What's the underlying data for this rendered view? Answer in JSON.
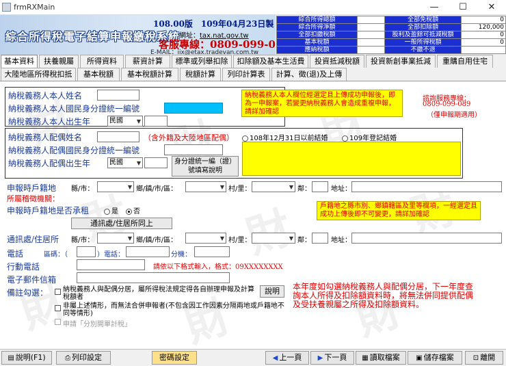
{
  "window": {
    "title": "frmRXMain",
    "minimize": "—",
    "maximize": "☐",
    "close": "✕"
  },
  "banner": {
    "version": "108.00版　109年04月23日製",
    "system_name": "綜合所得稅電子結算申報繳稅系統",
    "site_label": "網址：",
    "site_url": "tax.nat.gov.tw",
    "hotline": "客服專線：0809-099-089",
    "email": "E-MAIL：iix@etax.tradevan.com.tw"
  },
  "summary_left": [
    {
      "label": "綜合所得總額",
      "value": "0"
    },
    {
      "label": "綜合所得淨額",
      "value": "0"
    },
    {
      "label": "全部扣繳稅額",
      "value": "0"
    },
    {
      "label": "基本稅額",
      "value": "0"
    },
    {
      "label": "應納稅額",
      "value": "0"
    }
  ],
  "summary_right": [
    {
      "label": "全部免稅額",
      "value": "0"
    },
    {
      "label": "全部扣除額",
      "value": "120,000"
    },
    {
      "label": "股利及盈餘可抵減稅額",
      "value": "0"
    },
    {
      "label": "一般所得稅額",
      "value": "0"
    },
    {
      "label": "不繳不退",
      "value": ""
    }
  ],
  "tabs_row1": [
    "基本資料",
    "扶養親屬",
    "所得資料",
    "薪資計算",
    "標準或列舉扣除",
    "扣除額及基本生活費",
    "投資抵減稅額",
    "投資新創事業抵減",
    "重購自用住宅"
  ],
  "tabs_row2": [
    "大陸地區所得稅扣抵",
    "基本稅額",
    "基本稅額計算",
    "稅額計算",
    "列印計算表",
    "計算、徵(退)及上傳"
  ],
  "watermark": "財",
  "taxpayer": {
    "name_label": "納稅義務人本人姓名",
    "id_label": "納稅義務人本人國民身分證統一編號",
    "birth_label": "納稅義務人本人出生年",
    "era": "民國",
    "notice": "納稅義務人本人欄位經選定且上傳成功申報後，即為一申報案，若變更納稅義務人會造成重複申報，請詳加確認"
  },
  "consult": {
    "line1": "諮詢服務專線：",
    "line2": "0809-099-089",
    "line3": "（僅申報期適用）"
  },
  "spouse": {
    "name_label": "納稅義務人配偶姓名",
    "name_note": "（含外籍及大陸地區配偶）",
    "id_label": "納稅義務人配偶國民身分證統一編號",
    "birth_label": "納稅義務人配偶出生年",
    "era": "民國",
    "marriage_before": "108年12月31日以前結婚",
    "marriage_after": "109年登記結婚",
    "id_help_button": "身分證統一編（證）號填寫說明"
  },
  "household": {
    "label": "申報時戶籍地",
    "county": "縣/市：",
    "town": "鄉/鎮/市/區：",
    "village": "村/里：",
    "neighborhood": "鄰：",
    "address": "地址：",
    "office_label": "所屬稽徵機關：",
    "notice": "戶籍地之縣市別、鄉鎮轄區及里等欄項，一經選定且成功上傳後即不可變更，請詳加確認",
    "rent_label": "申報時戶籍地是否承租",
    "yes": "是",
    "no": "否",
    "same_button": "通訊處/住居所同上"
  },
  "mailing": {
    "label": "通訊處/住居所",
    "county": "縣/市：",
    "town": "鄉/鎮/市/區：",
    "village": "村/里：",
    "neighborhood": "鄰：",
    "address": "地址："
  },
  "contact": {
    "phone_label": "電話",
    "area_code": "區碼：（",
    "close_paren": "）電話：",
    "ext": "分機：",
    "mobile_label": "行動電話",
    "mobile_hint": "請依以下格式輸入，格式：09XXXXXXXX",
    "email_label": "電子郵件信箱"
  },
  "remarks": {
    "label": "備註勾選：",
    "opt1": "納稅義務人與配偶分居，屬所得稅法規定得各自辦理申報及計算稅額者",
    "opt2": "非屬上述情形，而無法合併申報者(不包含因工作因素分隔兩地或戶籍地不同等情形)",
    "opt3": "申請「分別開單計稅」",
    "explain_button": "說明",
    "notice": "本年度如勾選納稅義務人與配偶分居，下一年度查詢本人所得及扣除額資料時，將無法併同提供配偶及受扶養親屬之所得及扣除額資料。"
  },
  "bottom": {
    "help": "說明(F1)",
    "print_setup": "列印設定",
    "password": "密碼設定",
    "prev": "上一頁",
    "next": "下一頁",
    "load": "讀取檔案",
    "save": "儲存檔案",
    "exit": "離開"
  }
}
